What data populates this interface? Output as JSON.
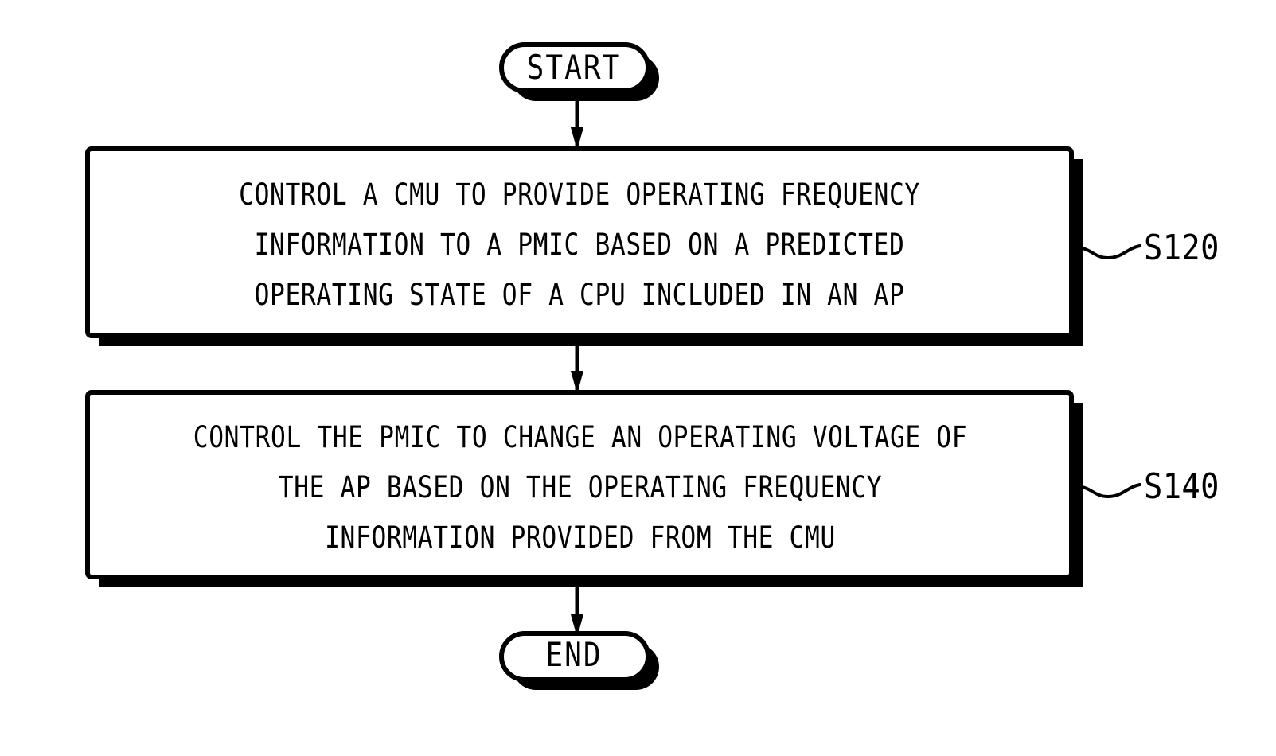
{
  "diagram": {
    "type": "flowchart",
    "orientation": "vertical",
    "background_color": "#ffffff",
    "stroke_color": "#000000",
    "nodes": [
      {
        "id": "start",
        "shape": "terminator",
        "label": "START"
      },
      {
        "id": "s120",
        "shape": "process",
        "reference": "S120",
        "lines": [
          "CONTROL A CMU TO PROVIDE OPERATING FREQUENCY",
          "INFORMATION TO A PMIC BASED ON A PREDICTED",
          "OPERATING STATE OF A CPU INCLUDED IN AN AP"
        ]
      },
      {
        "id": "s140",
        "shape": "process",
        "reference": "S140",
        "lines": [
          "CONTROL THE PMIC TO CHANGE AN OPERATING VOLTAGE OF",
          "THE AP BASED ON THE OPERATING FREQUENCY",
          "INFORMATION PROVIDED FROM THE CMU"
        ]
      },
      {
        "id": "end",
        "shape": "terminator",
        "label": "END"
      }
    ],
    "edges": [
      {
        "from": "start",
        "to": "s120",
        "arrow": "down"
      },
      {
        "from": "s120",
        "to": "s140",
        "arrow": "down"
      },
      {
        "from": "s140",
        "to": "end",
        "arrow": "down"
      }
    ]
  },
  "start_node": {
    "label": "START"
  },
  "end_node": {
    "label": "END"
  },
  "box_s120": {
    "reference": "S120",
    "line1": "CONTROL A CMU TO PROVIDE OPERATING FREQUENCY",
    "line2": "INFORMATION TO A PMIC BASED ON A PREDICTED",
    "line3": "OPERATING STATE OF A CPU INCLUDED IN AN AP"
  },
  "box_s140": {
    "reference": "S140",
    "line1": "CONTROL THE PMIC TO CHANGE AN OPERATING VOLTAGE OF",
    "line2": "THE AP BASED ON THE OPERATING FREQUENCY",
    "line3": "INFORMATION PROVIDED FROM THE CMU"
  }
}
